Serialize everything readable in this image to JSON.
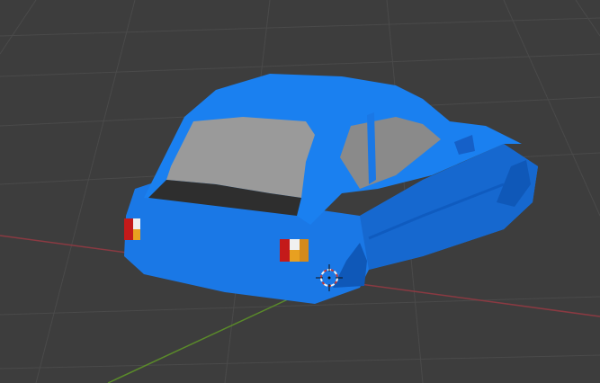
{
  "viewport": {
    "background": "#3d3d3d",
    "grid_color": "#4a4a4a",
    "x_axis_color": "#8a3a42",
    "y_axis_color": "#5a8a2a"
  },
  "scene": {
    "object": "car-body-shell",
    "body_color": "#1a78e6",
    "body_shade": "#0f5bbf",
    "interior_color": "#b8b8b8",
    "taillight_colors": [
      "#c41a1a",
      "#e8a020",
      "#f0f0f0"
    ]
  },
  "cursor_3d": {
    "icon": "3d-cursor-icon"
  }
}
